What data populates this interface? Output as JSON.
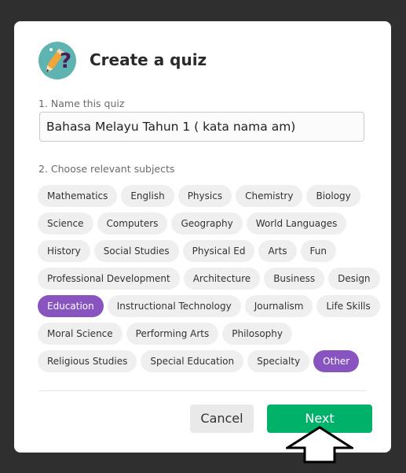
{
  "dialog": {
    "title": "Create a quiz",
    "name_label": "1. Name this quiz",
    "name_value": "Bahasa Melayu Tahun 1 ( kata nama am)",
    "subjects_label": "2. Choose relevant subjects",
    "subject_rows": [
      [
        "Mathematics",
        "English",
        "Physics",
        "Chemistry",
        "Biology"
      ],
      [
        "Science",
        "Computers",
        "Geography",
        "World Languages"
      ],
      [
        "History",
        "Social Studies",
        "Physical Ed",
        "Arts",
        "Fun"
      ],
      [
        "Professional Development",
        "Architecture",
        "Business",
        "Design"
      ],
      [
        "Education",
        "Instructional Technology",
        "Journalism",
        "Life Skills"
      ],
      [
        "Moral Science",
        "Performing Arts",
        "Philosophy"
      ],
      [
        "Religious Studies",
        "Special Education",
        "Specialty",
        "Other"
      ]
    ],
    "selected_subjects": [
      "Education",
      "Other"
    ],
    "cancel_label": "Cancel",
    "next_label": "Next"
  },
  "colors": {
    "selected_chip": "#8854c0",
    "next_button": "#00b16a",
    "backdrop": "#2f2f2f"
  },
  "icons": {
    "logo": "quiz-question-pencil-icon",
    "cursor": "arrow-up-cursor-icon"
  }
}
